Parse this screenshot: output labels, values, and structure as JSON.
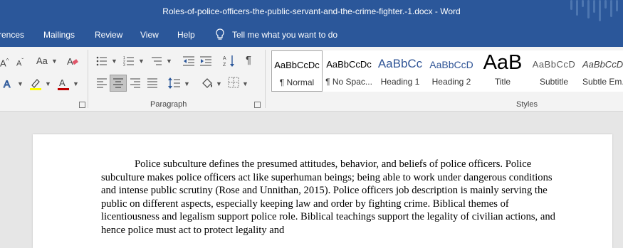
{
  "window": {
    "title": "Roles-of-police-officers-the-public-servant-and-the-crime-fighter.-1.docx  -  Word"
  },
  "tabs": [
    "rences",
    "Mailings",
    "Review",
    "View",
    "Help"
  ],
  "tell_me": {
    "icon": "lightbulb-icon",
    "label": "Tell me what you want to do"
  },
  "ribbon": {
    "font_group": {
      "change_case": "Aa"
    },
    "paragraph_group": {
      "label": "Paragraph",
      "show_marks_glyph": "¶"
    },
    "styles_group": {
      "label": "Styles",
      "items": [
        {
          "sample": "AaBbCcDc",
          "name": "¶ Normal"
        },
        {
          "sample": "AaBbCcDc",
          "name": "¶ No Spac..."
        },
        {
          "sample": "AaBbCc",
          "name": "Heading 1"
        },
        {
          "sample": "AaBbCcD",
          "name": "Heading 2"
        },
        {
          "sample": "AaB",
          "name": "Title"
        },
        {
          "sample": "AaBbCcD",
          "name": "Subtitle"
        },
        {
          "sample": "AaBbCcD",
          "name": "Subtle Em..."
        }
      ]
    }
  },
  "document": {
    "paragraph": "Police subculture defines the presumed attitudes, behavior, and beliefs of police officers. Police subculture makes police officers act like superhuman beings; being able to work under dangerous conditions and intense public scrutiny (Rose and Unnithan, 2015). Police officers job description is mainly serving the public on different aspects, especially keeping law and order by fighting crime. Biblical themes of licentiousness and legalism support police role. Biblical teachings support the legality of civilian actions, and hence police must act to protect legality and"
  },
  "colors": {
    "titlebar": "#2b579a",
    "ribbon": "#f3f3f3",
    "document_bg": "#e6e6e6",
    "heading_blue": "#2f5496",
    "highlight_yellow": "#ffff00",
    "font_color_red": "#c00000"
  }
}
